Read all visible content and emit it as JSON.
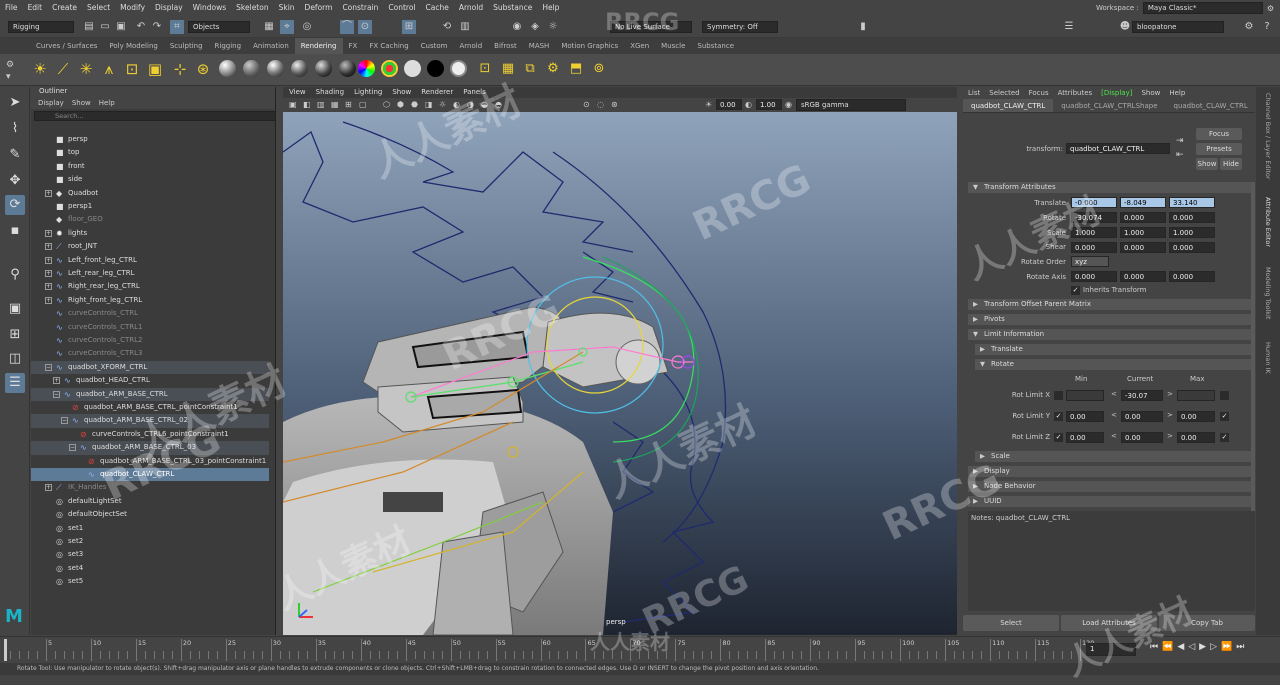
{
  "menubar": {
    "items": [
      "File",
      "Edit",
      "Create",
      "Select",
      "Modify",
      "Display",
      "Windows",
      "Skeleton",
      "Skin",
      "Deform",
      "Constrain",
      "Control",
      "Cache",
      "Arnold",
      "Substance",
      "Help"
    ],
    "workspace_label": "Workspace :",
    "workspace_value": "Maya Classic*"
  },
  "statusline": {
    "mode": "Rigging",
    "objects": "Objects",
    "live_surface": "No Live Surface",
    "symmetry": "Symmetry: Off",
    "user": "bloopatone"
  },
  "shelf": {
    "tabs": [
      "Curves / Surfaces",
      "Poly Modeling",
      "Sculpting",
      "Rigging",
      "Animation",
      "Rendering",
      "FX",
      "FX Caching",
      "Custom",
      "Arnold",
      "Bifrost",
      "MASH",
      "Motion Graphics",
      "XGen",
      "Muscle",
      "Substance"
    ],
    "active_tab": "Rendering"
  },
  "outliner": {
    "title": "Outliner",
    "menu": [
      "Display",
      "Show",
      "Help"
    ],
    "search_placeholder": "Search...",
    "rows": [
      {
        "label": "persp"
      },
      {
        "label": "top"
      },
      {
        "label": "front"
      },
      {
        "label": "side"
      },
      {
        "label": "Quadbot"
      },
      {
        "label": "persp1"
      },
      {
        "label": "floor_GEO"
      },
      {
        "label": "lights"
      },
      {
        "label": "root_JNT"
      },
      {
        "label": "Left_front_leg_CTRL"
      },
      {
        "label": "Left_rear_leg_CTRL"
      },
      {
        "label": "Right_rear_leg_CTRL"
      },
      {
        "label": "Right_front_leg_CTRL"
      },
      {
        "label": "curveControls_CTRL"
      },
      {
        "label": "curveControls_CTRL1"
      },
      {
        "label": "curveControls_CTRL2"
      },
      {
        "label": "curveControls_CTRL3"
      },
      {
        "label": "quadbot_XFORM_CTRL"
      },
      {
        "label": "quadbot_HEAD_CTRL"
      },
      {
        "label": "quadbot_ARM_BASE_CTRL"
      },
      {
        "label": "quadbot_ARM_BASE_CTRL_pointConstraint1"
      },
      {
        "label": "quadbot_ARM_BASE_CTRL_02"
      },
      {
        "label": "curveControls_CTRL6_pointConstraint1"
      },
      {
        "label": "quadbot_ARM_BASE_CTRL_03"
      },
      {
        "label": "quadbot_ARM_BASE_CTRL_03_pointConstraint1"
      },
      {
        "label": "quadbot_CLAW_CTRL"
      },
      {
        "label": "IK_Handles"
      },
      {
        "label": "defaultLightSet"
      },
      {
        "label": "defaultObjectSet"
      },
      {
        "label": "set1"
      },
      {
        "label": "set2"
      },
      {
        "label": "set3"
      },
      {
        "label": "set4"
      },
      {
        "label": "set5"
      }
    ]
  },
  "viewport": {
    "menu": [
      "View",
      "Shading",
      "Lighting",
      "Show",
      "Renderer",
      "Panels"
    ],
    "exposure": "0.00",
    "gamma": "1.00",
    "color_space": "sRGB gamma",
    "camera_label": "persp"
  },
  "attribute_editor": {
    "menu": [
      "List",
      "Selected",
      "Focus",
      "Attributes",
      "Display",
      "Show",
      "Help"
    ],
    "active_menu": "Display",
    "tabs": [
      "quadbot_CLAW_CTRL",
      "quadbot_CLAW_CTRLShape",
      "quadbot_CLAW_CTRL"
    ],
    "transform_label": "transform:",
    "transform_value": "quadbot_CLAW_CTRL",
    "focus_button": "Focus",
    "presets_button": "Presets",
    "show_button": "Show",
    "hide_button": "Hide",
    "transform_section": "Transform Attributes",
    "translate_label": "Translate",
    "translate": [
      "-0.000",
      "-8.049",
      "33.140"
    ],
    "rotate_label": "Rotate",
    "rotate": [
      "-30.074",
      "0.000",
      "0.000"
    ],
    "scale_label": "Scale",
    "scale": [
      "1.000",
      "1.000",
      "1.000"
    ],
    "shear_label": "Shear",
    "shear": [
      "0.000",
      "0.000",
      "0.000"
    ],
    "rotate_order_label": "Rotate Order",
    "rotate_order": "xyz",
    "rotate_axis_label": "Rotate Axis",
    "rotate_axis": [
      "0.000",
      "0.000",
      "0.000"
    ],
    "inherits_transform": "Inherits Transform",
    "sections": [
      "Transform Offset Parent Matrix",
      "Pivots",
      "Limit Information",
      "Translate",
      "Rotate"
    ],
    "limit_headers": [
      "Min",
      "Current",
      "Max"
    ],
    "rot_limits": [
      {
        "label": "Rot Limit X",
        "min": "",
        "current": "-30.07",
        "max": "",
        "min_checked": false,
        "max_checked": false
      },
      {
        "label": "Rot Limit Y",
        "min": "0.00",
        "current": "0.00",
        "max": "0.00",
        "min_checked": true,
        "max_checked": true
      },
      {
        "label": "Rot Limit Z",
        "min": "0.00",
        "current": "0.00",
        "max": "0.00",
        "min_checked": true,
        "max_checked": true
      }
    ],
    "sections_after": [
      "Scale",
      "Display",
      "Node Behavior",
      "UUID"
    ],
    "notes": "Notes:  quadbot_CLAW_CTRL",
    "bottom_buttons": [
      "Select",
      "Load Attributes",
      "Copy Tab"
    ]
  },
  "side_tabs": [
    "Channel Box / Layer Editor",
    "Attribute Editor",
    "Modeling Toolkit",
    "Human IK"
  ],
  "timeline": {
    "ticks": [
      "5",
      "10",
      "15",
      "20",
      "25",
      "30",
      "35",
      "40",
      "45",
      "50",
      "55",
      "60",
      "65",
      "70",
      "75",
      "80",
      "85",
      "90",
      "95",
      "100",
      "105",
      "110",
      "115",
      "120"
    ],
    "current_frame": "1"
  },
  "help_line": "Rotate Tool: Use manipulator to rotate object(s). Shift+drag manipulator axis or plane handles to extrude components or clone objects. Ctrl+Shift+LMB+drag to constrain rotation to connected edges. Use D or INSERT to change the pivot position and axis orientation.",
  "watermarks": [
    "RRCG",
    "人人素材",
    "RRCG",
    "人人素材",
    "RRCG",
    "人人素材",
    "RRCG",
    "人人素材",
    "RRCG",
    "人人素材",
    "RRCG",
    "人人素材",
    "人人素材"
  ],
  "maya_logo": "M"
}
